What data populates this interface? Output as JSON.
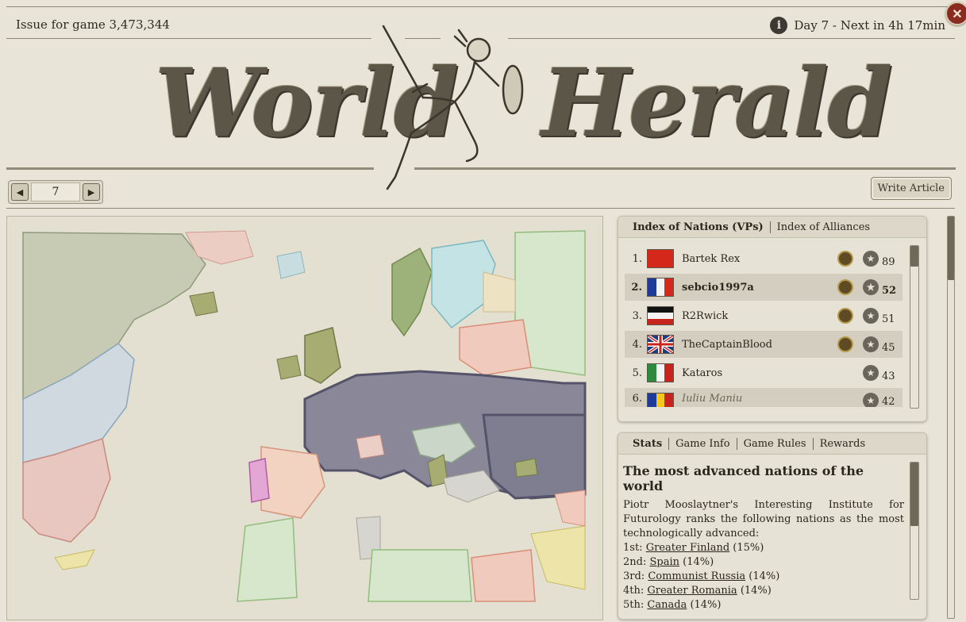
{
  "header": {
    "issue": "Issue for game 3,473,344",
    "day": "Day 7 - Next in 4h 17min",
    "title_left": "World",
    "title_right": "Herald"
  },
  "pager": {
    "page": "7"
  },
  "write_article": "Write Article",
  "index_panel": {
    "tabs": [
      "Index of Nations (VPs)",
      "Index of Alliances"
    ],
    "rows": [
      {
        "rank": "1.",
        "name": "Bartek Rex",
        "vp": "89"
      },
      {
        "rank": "2.",
        "name": "sebcio1997a",
        "vp": "52"
      },
      {
        "rank": "3.",
        "name": "R2Rwick",
        "vp": "51"
      },
      {
        "rank": "4.",
        "name": "TheCaptainBlood",
        "vp": "45"
      },
      {
        "rank": "5.",
        "name": "Kataros",
        "vp": "43"
      },
      {
        "rank": "6.",
        "name": "Iuliu Maniu",
        "vp": "42"
      }
    ]
  },
  "stats_panel": {
    "tabs": [
      "Stats",
      "Game Info",
      "Game Rules",
      "Rewards"
    ],
    "title": "The most advanced nations of the world",
    "intro": "Piotr Mooslaytner's Interesting Institute for Futurology ranks the following nations as the most technologically advanced:",
    "ranks": [
      {
        "place": "1st:",
        "nation": "Greater Finland",
        "pct": "(15%)"
      },
      {
        "place": "2nd:",
        "nation": "Spain",
        "pct": "(14%)"
      },
      {
        "place": "3rd:",
        "nation": "Communist Russia",
        "pct": "(14%)"
      },
      {
        "place": "4th:",
        "nation": "Greater Romania",
        "pct": "(14%)"
      },
      {
        "place": "5th:",
        "nation": "Canada",
        "pct": "(14%)"
      }
    ]
  },
  "colors": {
    "paper": "#e8e4d7",
    "ink": "#2b261e",
    "axis_power": "#8a8898",
    "map_water": "#e3dfd1"
  }
}
